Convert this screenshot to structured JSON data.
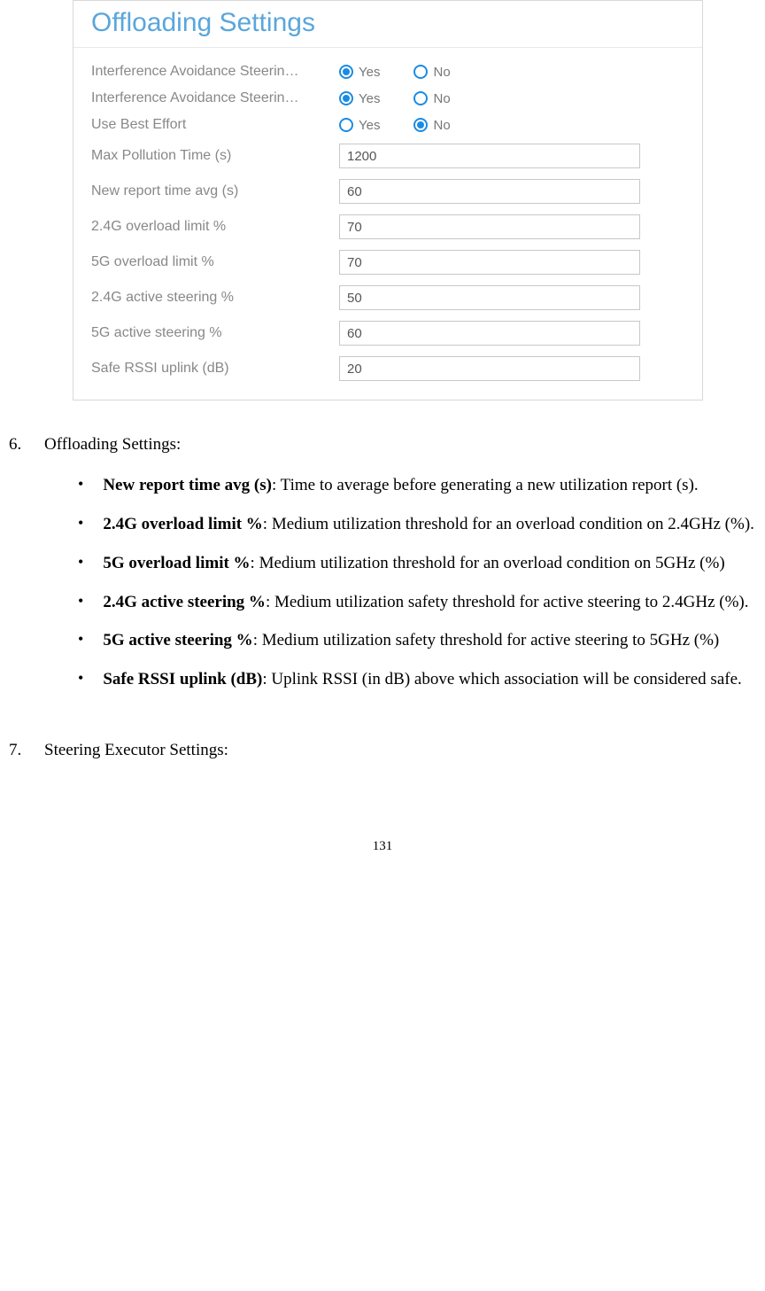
{
  "panel": {
    "title": "Offloading Settings",
    "rows": [
      {
        "label": "Interference Avoidance Steerin…",
        "type": "radio",
        "yes": true,
        "no": false,
        "yesLabel": "Yes",
        "noLabel": "No"
      },
      {
        "label": "Interference Avoidance Steerin…",
        "type": "radio",
        "yes": true,
        "no": false,
        "yesLabel": "Yes",
        "noLabel": "No"
      },
      {
        "label": "Use Best Effort",
        "type": "radio",
        "yes": false,
        "no": true,
        "yesLabel": "Yes",
        "noLabel": "No"
      },
      {
        "label": "Max Pollution Time (s)",
        "type": "text",
        "value": "1200"
      },
      {
        "label": "New report time avg (s)",
        "type": "text",
        "value": "60"
      },
      {
        "label": "2.4G overload limit %",
        "type": "text",
        "value": "70"
      },
      {
        "label": "5G overload limit %",
        "type": "text",
        "value": "70"
      },
      {
        "label": "2.4G active steering %",
        "type": "text",
        "value": "50"
      },
      {
        "label": "5G active steering %",
        "type": "text",
        "value": "60"
      },
      {
        "label": "Safe RSSI uplink (dB)",
        "type": "text",
        "value": "20"
      }
    ]
  },
  "doc": {
    "item6": {
      "num": "6.",
      "title": "Offloading Settings:"
    },
    "bullets": [
      {
        "term": "New report time avg (s)",
        "desc": ": Time to average before generating a new utilization report (s)."
      },
      {
        "term": "2.4G overload limit %",
        "desc": ": Medium utilization threshold for an overload condition on 2.4GHz (%)."
      },
      {
        "term": "5G overload limit %",
        "desc": ": Medium utilization threshold for an overload condition on 5GHz (%)"
      },
      {
        "term": "2.4G active steering %",
        "desc": ": Medium utilization safety threshold for active steering to 2.4GHz (%)."
      },
      {
        "term": "5G active steering %",
        "desc": ": Medium utilization safety threshold for active steering to 5GHz (%)"
      },
      {
        "term": "Safe RSSI uplink (dB)",
        "desc": ": Uplink RSSI (in dB) above which association will be considered safe."
      }
    ],
    "item7": {
      "num": "7.",
      "title": "Steering Executor Settings:"
    },
    "pageNum": "131"
  }
}
